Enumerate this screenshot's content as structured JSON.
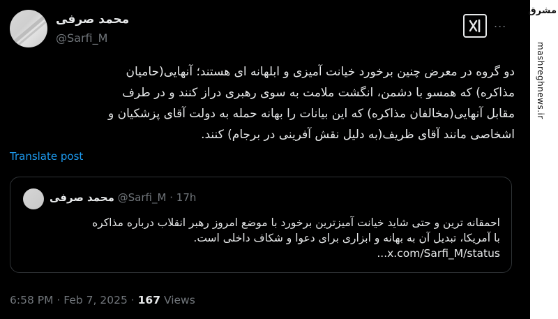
{
  "author": {
    "display_name": "محمد صرفی",
    "handle": "@Sarfi_M"
  },
  "header_icons": {
    "brand_icon": "x-grok-icon",
    "more_icon": "more-dots-icon",
    "more_glyph": "..."
  },
  "tweet": {
    "text_lines": [
      "دو گروه در معرض چنین برخورد خیانت آمیزی و ابلهانه ای هستند؛ آنهایی(حامیان",
      "مذاکره) که همسو با دشمن، انگشت ملامت به سوی رهبری دراز کنند و در طرف",
      "مقابل آنهایی(مخالفان مذاکره) که این بیانات را بهانه حمله به دولت آقای پزشکیان و",
      "اشخاصی مانند آقای ظریف(به دلیل نقش آفرینی در برجام) کنند."
    ],
    "translate_label": "Translate post"
  },
  "quote": {
    "display_name": "محمد صرفی",
    "handle": "@Sarfi_M",
    "separator": "·",
    "time": "17h",
    "text_lines": [
      "احمقانه ترین و حتی شاید خیانت آمیزترین برخورد با موضع امروز رهبر انقلاب درباره مذاکره",
      "با آمریکا، تبدیل آن به بهانه و ابزاری برای دعوا و شکاف داخلی است."
    ],
    "link": "x.com/Sarfi_M/status..."
  },
  "meta": {
    "time": "6:58 PM",
    "separator": "·",
    "date": "Feb 7, 2025",
    "views_count": "167",
    "views_label": "Views"
  },
  "watermark": {
    "logo_text": "مشرق",
    "site": "mashreghnews.ir"
  }
}
